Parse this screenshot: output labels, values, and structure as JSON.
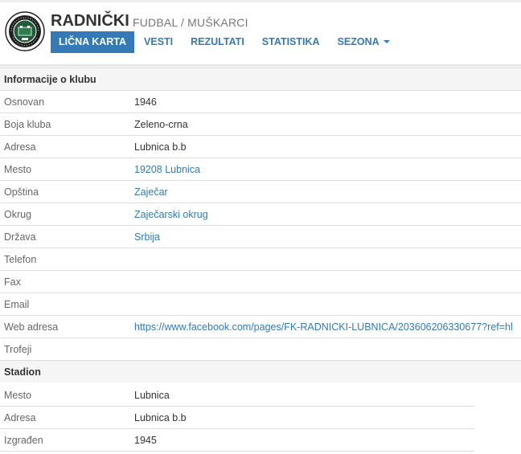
{
  "club": {
    "name": "RADNIČKI",
    "subtitle": "FUDBAL / MUŠKARCI",
    "logo_icon": "club-crest-icon"
  },
  "nav": {
    "items": [
      {
        "label": "LIČNA KARTA",
        "active": true
      },
      {
        "label": "VESTI"
      },
      {
        "label": "REZULTATI"
      },
      {
        "label": "STATISTIKA"
      },
      {
        "label": "SEZONA",
        "dropdown": true
      }
    ]
  },
  "info": {
    "section_title": "Informacije o klubu",
    "rows": [
      {
        "label": "Osnovan",
        "value": "1946"
      },
      {
        "label": "Boja kluba",
        "value": "Zeleno-crna"
      },
      {
        "label": "Adresa",
        "value": "Lubnica b.b"
      },
      {
        "label": "Mesto",
        "value": "19208 Lubnica",
        "link": true
      },
      {
        "label": "Opština",
        "value": "Zaječar",
        "link": true
      },
      {
        "label": "Okrug",
        "value": "Zaječarski okrug",
        "link": true
      },
      {
        "label": "Država",
        "value": "Srbija",
        "link": true
      },
      {
        "label": "Telefon",
        "value": ""
      },
      {
        "label": "Fax",
        "value": ""
      },
      {
        "label": "Email",
        "value": ""
      },
      {
        "label": "Web adresa",
        "value": "https://www.facebook.com/pages/FK-RADNICKI-LUBNICA/203606206330677?ref=hl",
        "link": true
      },
      {
        "label": "Trofeji",
        "value": ""
      }
    ]
  },
  "stadion": {
    "section_title": "Stadion",
    "rows": [
      {
        "label": "Mesto",
        "value": "Lubnica"
      },
      {
        "label": "Adresa",
        "value": "Lubnica b.b"
      },
      {
        "label": "Izgrađen",
        "value": "1945"
      }
    ]
  },
  "colors": {
    "link": "#337ab7",
    "nav_active_bg": "#337ab7",
    "section_bg": "#f5f5f5",
    "crest_green": "#1f5c3a"
  }
}
